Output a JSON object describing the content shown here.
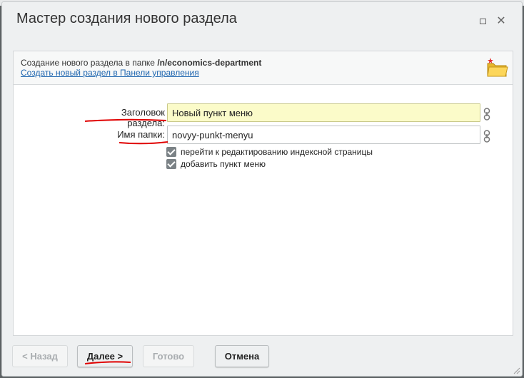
{
  "dialog": {
    "title": "Мастер создания нового раздела",
    "maximize_icon": "maximize-icon",
    "close_icon": "close-icon"
  },
  "header": {
    "line_prefix": "Создание нового раздела в папке ",
    "folder_path": "/n/economics-department",
    "link_text": "Создать новый раздел в Панели управления",
    "icon": "folder-new-icon"
  },
  "form": {
    "title_label": "Заголовок раздела:",
    "title_value": "Новый пункт меню",
    "folder_label": "Имя папки:",
    "folder_value": "novyy-punkt-menyu",
    "link_icon": "chain-link-icon",
    "checkbox_edit_label": "перейти к редактированию индексной страницы",
    "checkbox_menu_label": "добавить пункт меню"
  },
  "buttons": {
    "back": "< Назад",
    "next": "Далее >",
    "done": "Готово",
    "cancel": "Отмена"
  },
  "colors": {
    "highlight_input": "#fbfbc9",
    "annotation_red": "#e00000",
    "link_blue": "#2067b0"
  }
}
